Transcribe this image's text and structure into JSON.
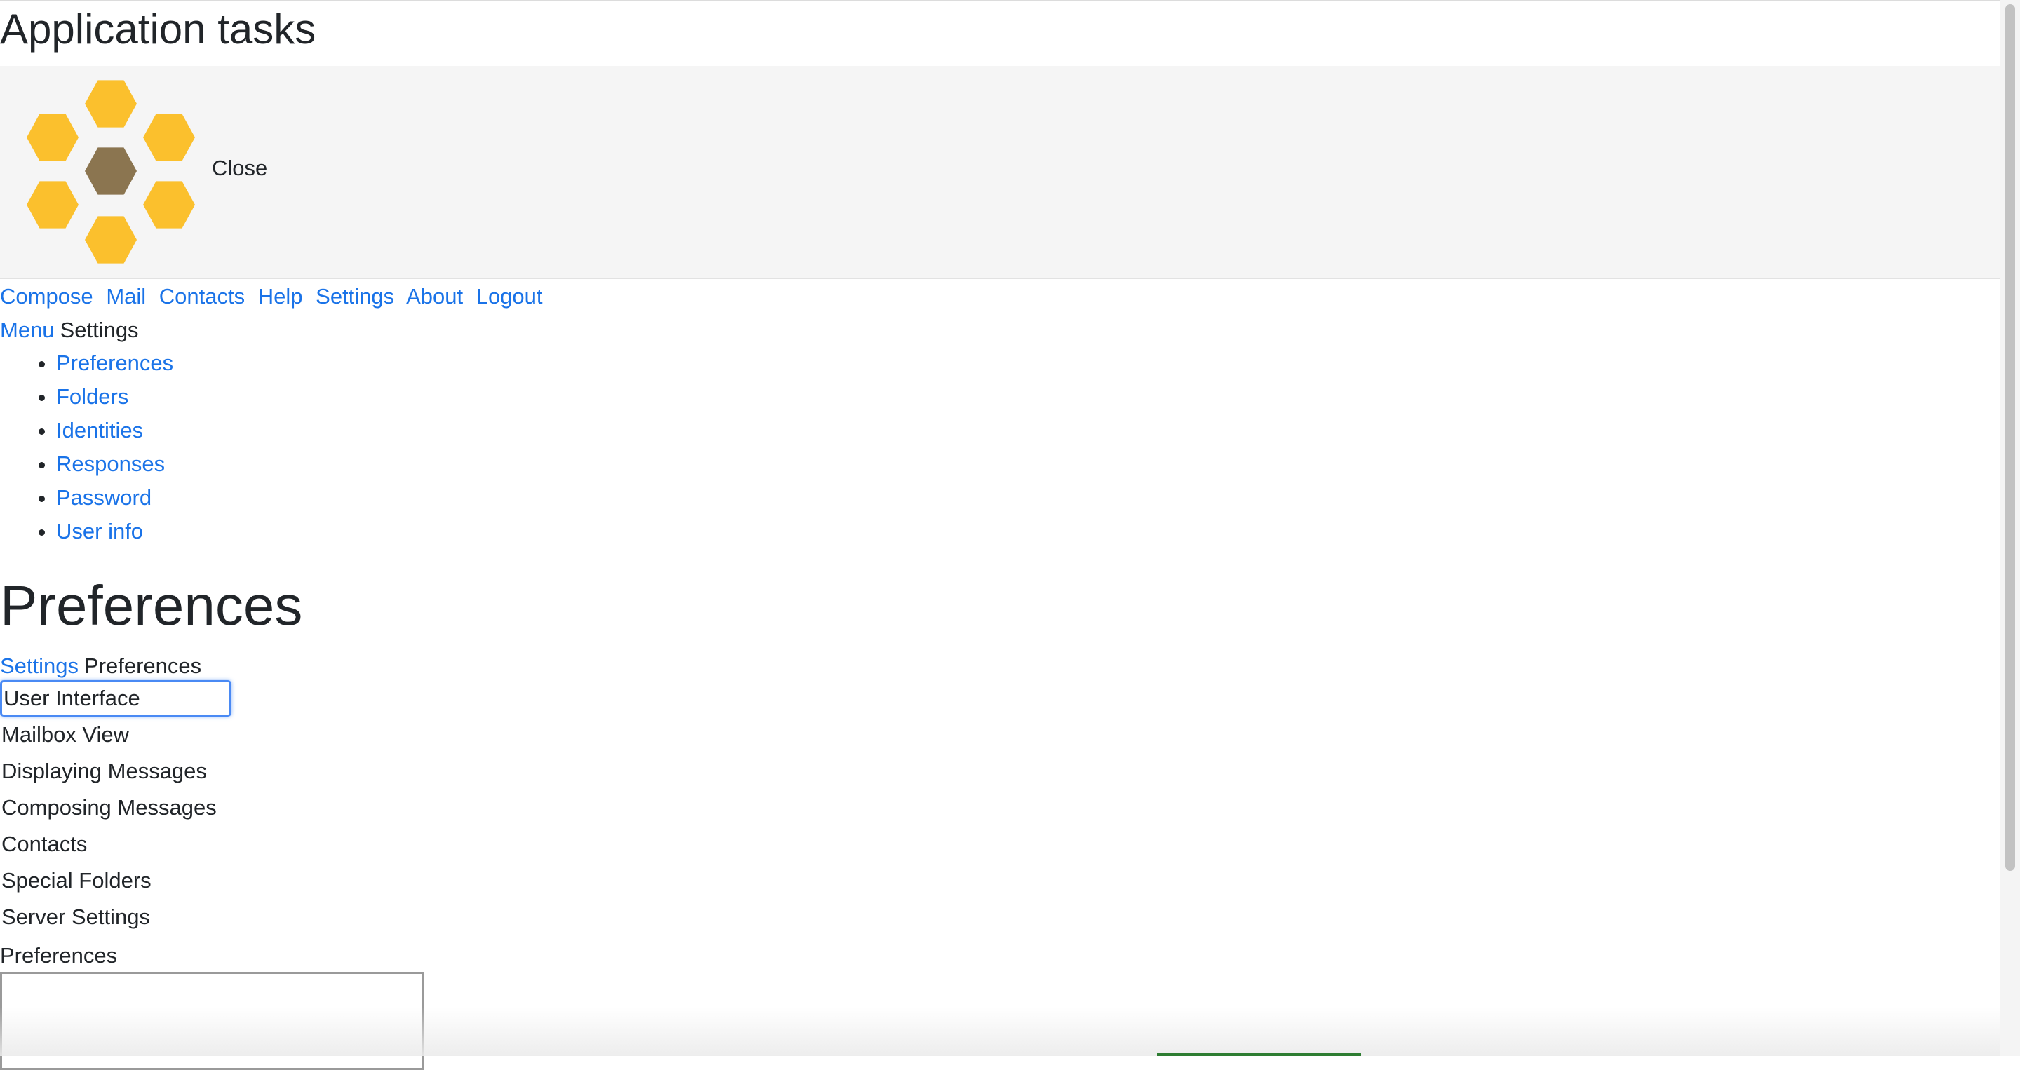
{
  "app": {
    "title": "Application tasks"
  },
  "header": {
    "logo_icon": "honeycomb-logo-icon",
    "close_label": "Close",
    "hex_colors": {
      "outer": "#fbc02d",
      "center": "#8b7550"
    }
  },
  "nav": {
    "items": [
      {
        "label": "Compose"
      },
      {
        "label": "Mail"
      },
      {
        "label": "Contacts"
      },
      {
        "label": "Help"
      },
      {
        "label": "Settings"
      },
      {
        "label": "About"
      },
      {
        "label": "Logout"
      }
    ]
  },
  "menu": {
    "link_label": "Menu",
    "current": "Settings"
  },
  "settings_list": [
    {
      "label": "Preferences"
    },
    {
      "label": "Folders"
    },
    {
      "label": "Identities"
    },
    {
      "label": "Responses"
    },
    {
      "label": "Password"
    },
    {
      "label": "User info"
    }
  ],
  "section": {
    "title": "Preferences"
  },
  "breadcrumb": {
    "parent": "Settings",
    "current": "Preferences"
  },
  "preferences": [
    {
      "label": "User Interface",
      "selected": true
    },
    {
      "label": "Mailbox View"
    },
    {
      "label": "Displaying Messages"
    },
    {
      "label": "Composing Messages"
    },
    {
      "label": "Contacts"
    },
    {
      "label": "Special Folders"
    },
    {
      "label": "Server Settings"
    }
  ],
  "frame": {
    "label": "Preferences"
  },
  "colors": {
    "link": "#1a73e8",
    "focus": "#4a8af4"
  }
}
